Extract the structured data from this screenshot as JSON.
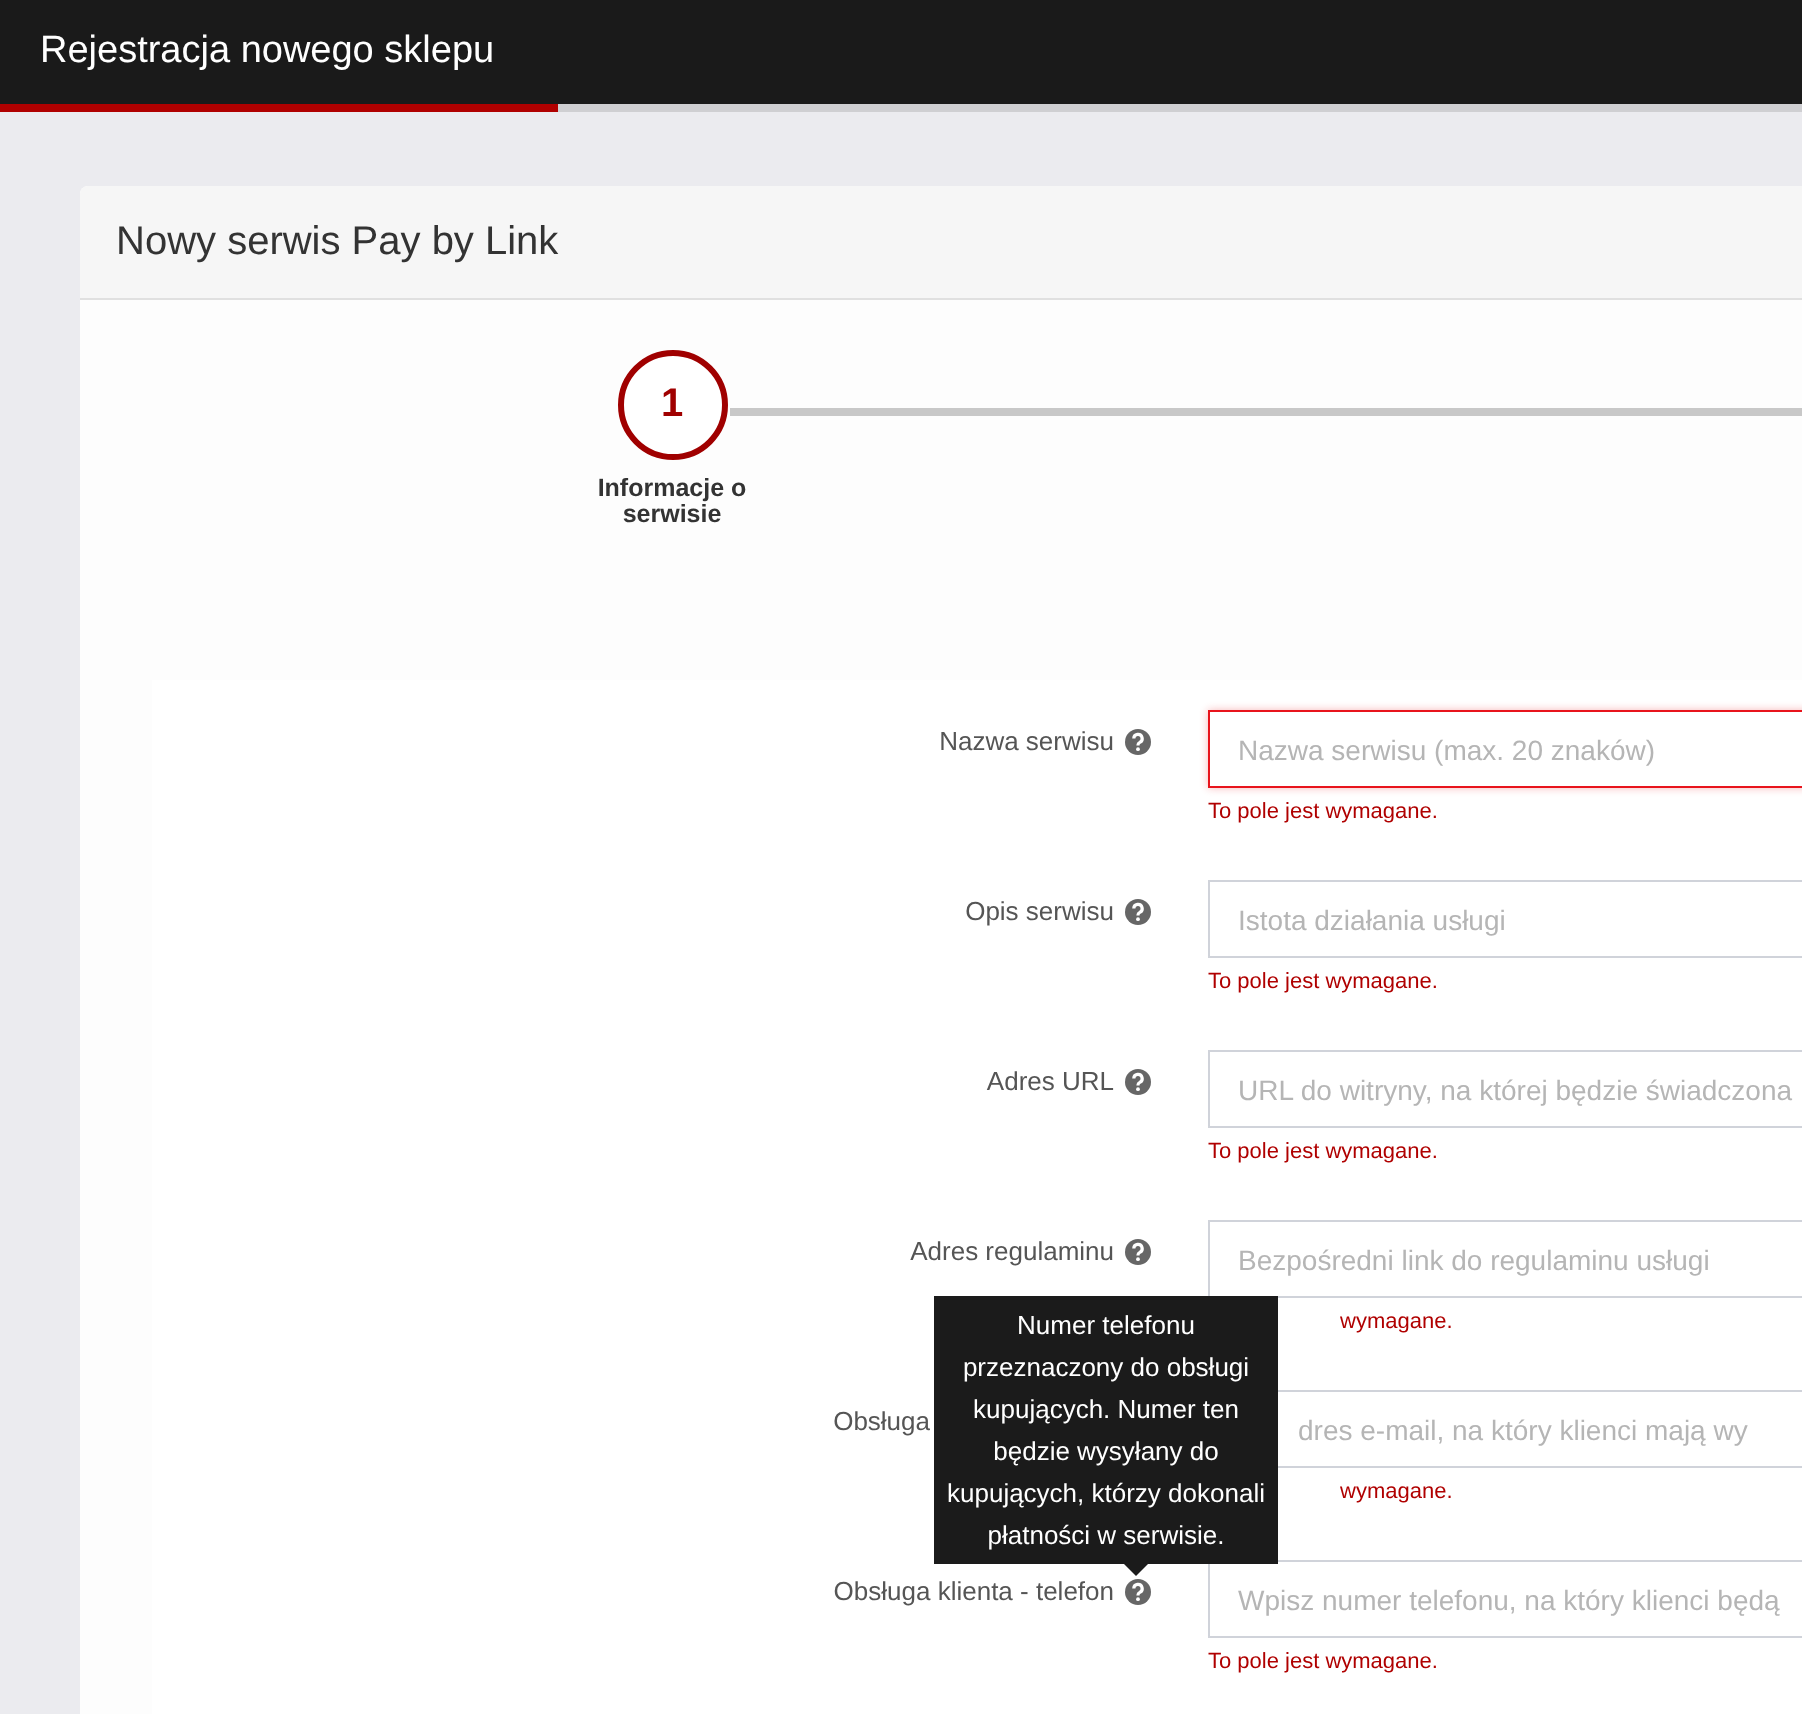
{
  "top_bar": {
    "title": "Rejestracja nowego sklepu",
    "progress": {
      "level": 0.31
    }
  },
  "card": {
    "title": "Nowy serwis Pay by Link"
  },
  "steps": [
    {
      "number": "1",
      "label": "Informacje o serwisie",
      "active": true
    }
  ],
  "fields": [
    {
      "kind": "plain",
      "label": "Nazwa serwisu",
      "placeholder": "Nazwa serwisu (max. 20 znaków)",
      "invalid": true,
      "error": "To pole jest wymagane."
    },
    {
      "kind": "plain",
      "label": "Opis serwisu",
      "placeholder": "Istota działania usługi",
      "invalid": false,
      "error": "To pole jest wymagane."
    },
    {
      "kind": "plain",
      "label": "Adres URL",
      "placeholder": "URL do witryny, na której będzie świadczona",
      "invalid": false,
      "error": "To pole jest wymagane."
    },
    {
      "kind": "error_covered",
      "label": "Adres regulaminu",
      "placeholder": "Bezpośredni link do regulaminu usługi",
      "invalid": false,
      "error": "wymagane."
    },
    {
      "kind": "covered",
      "label": "Obsługa",
      "placeholder": "dres e-mail, na który klienci mają wy",
      "invalid": false,
      "error": "wymagane."
    },
    {
      "kind": "plain",
      "label": "Obsługa klienta - telefon",
      "placeholder": "Wpisz numer telefonu, na który klienci będą",
      "invalid": false,
      "error": "To pole jest wymagane."
    }
  ],
  "tooltip": {
    "text": "Numer telefonu przeznaczony do obsługi kupujących. Numer ten będzie wysyłany do kupujących, którzy dokonali płatności w serwisie."
  }
}
